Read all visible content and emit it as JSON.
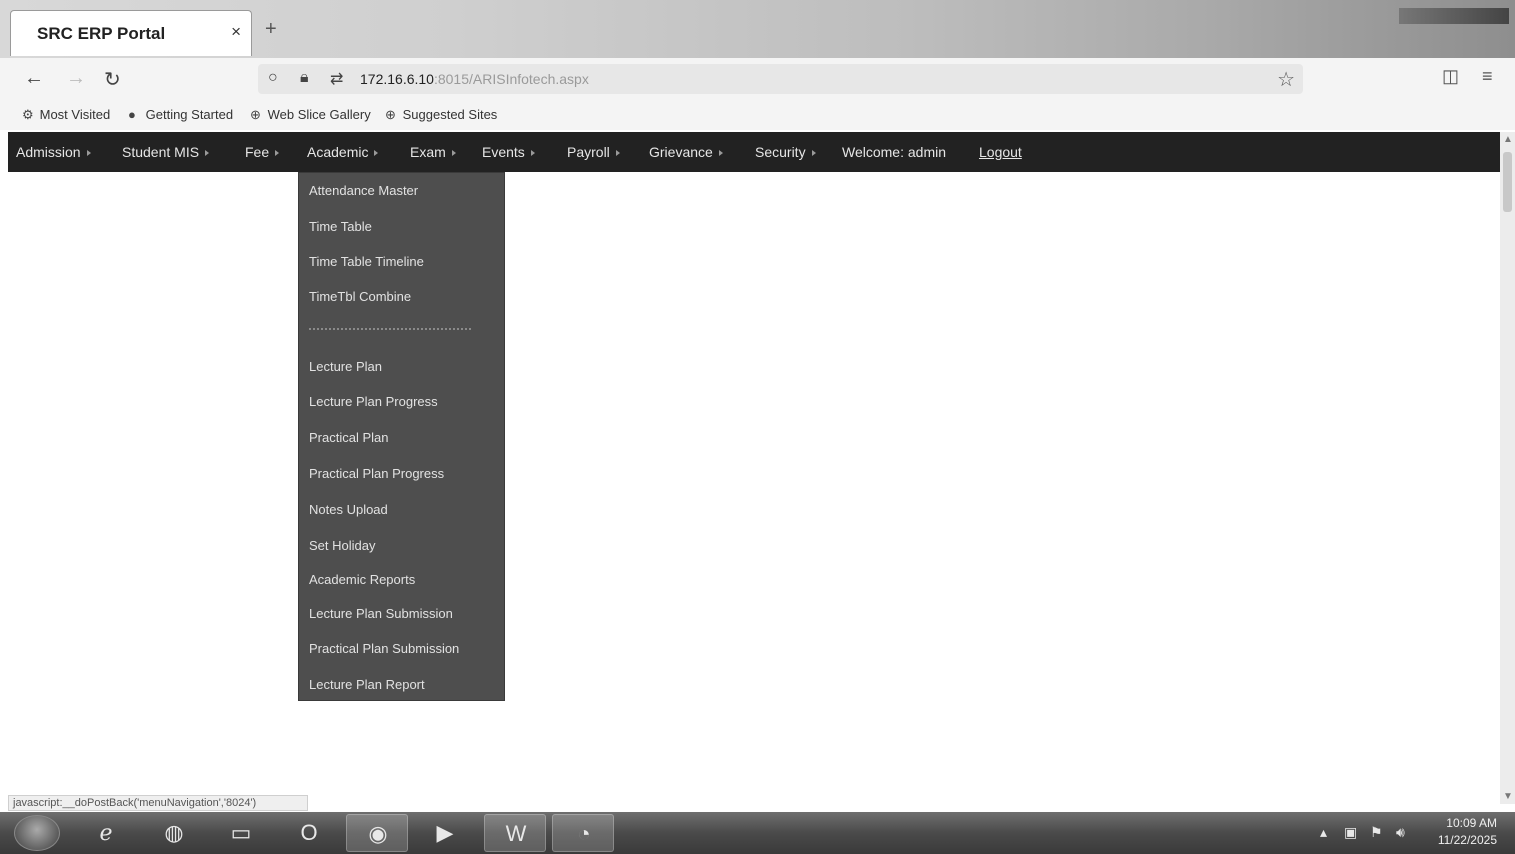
{
  "browser": {
    "tab_title": "SRC ERP Portal",
    "tab_close": "×",
    "new_tab": "+",
    "url_host": "172.16.6.10",
    "url_path": ":8015/ARISInfotech.aspx",
    "bookmarks": [
      {
        "label": "Most Visited",
        "icon": "gear-icon"
      },
      {
        "label": "Getting Started",
        "icon": "firefox-icon"
      },
      {
        "label": "Web Slice Gallery",
        "icon": "globe-icon"
      },
      {
        "label": "Suggested Sites",
        "icon": "globe-icon"
      }
    ],
    "status_text": "javascript:__doPostBack('menuNavigation','8024')"
  },
  "menu": {
    "items": [
      "Admission",
      "Student MIS",
      "Fee",
      "Academic",
      "Exam",
      "Events",
      "Payroll",
      "Grievance",
      "Security"
    ],
    "welcome": "Welcome: admin",
    "logout": "Logout"
  },
  "dropdown": {
    "items": [
      "Attendance Master",
      "Time Table",
      "Time Table Timeline",
      "TimeTbl Combine",
      "Lecture Plan",
      "Lecture Plan Progress",
      "Practical Plan",
      "Practical Plan Progress",
      "Notes Upload",
      "Set Holiday",
      "Academic Reports",
      "Lecture Plan Submission",
      "Practical Plan Submission",
      "Lecture Plan Report"
    ]
  },
  "taskbar": {
    "time": "10:09 AM",
    "date": "11/22/2025"
  }
}
